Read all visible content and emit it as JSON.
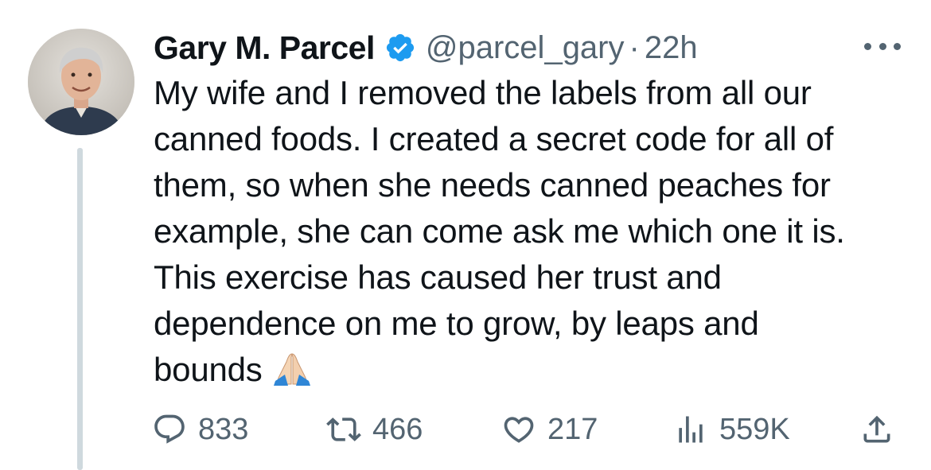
{
  "author": {
    "display_name": "Gary M. Parcel",
    "handle": "@parcel_gary",
    "separator": "·",
    "timestamp": "22h",
    "verified": true
  },
  "tweet": {
    "lines": [
      "My wife and I removed the labels from all our",
      "canned foods. I created a secret code for all of",
      "them, so when she needs canned peaches for",
      "example, she can come ask me which one it is.",
      "This exercise has caused her trust and",
      "dependence on me to grow, by leaps and",
      "bounds"
    ],
    "emoji": "folded-hands"
  },
  "metrics": {
    "replies": "833",
    "retweets": "466",
    "likes": "217",
    "views": "559K"
  },
  "icons": {
    "reply": "reply-icon",
    "retweet": "retweet-icon",
    "like": "heart-icon",
    "views": "views-icon",
    "share": "share-icon",
    "more": "more-icon",
    "verified": "verified-badge-icon"
  },
  "colors": {
    "text": "#0f1419",
    "secondary": "#536471",
    "verified": "#1d9bf0",
    "thread_line": "#cfd9de"
  }
}
